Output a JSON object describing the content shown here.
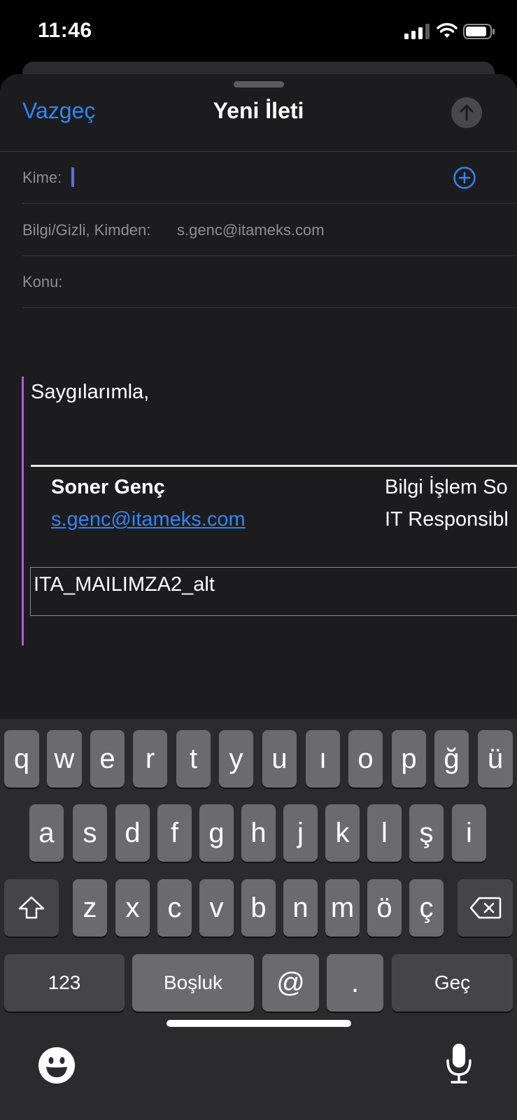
{
  "status_bar": {
    "time": "11:46",
    "icons": [
      "signal-icon",
      "wifi-icon",
      "battery-icon"
    ]
  },
  "compose": {
    "cancel_label": "Vazgeç",
    "title": "Yeni İleti",
    "send_icon": "arrow-up-icon",
    "to_label": "Kime:",
    "cc_from_label": "Bilgi/Gizli, Kimden:",
    "from_value": "s.genc@itameks.com",
    "subject_label": "Konu:",
    "add_contact_icon": "plus-circle-icon"
  },
  "body": {
    "greeting": "Saygılarımla,",
    "signature": {
      "name": "Soner Genç",
      "email": "s.genc@itameks.com",
      "title_tr": "Bilgi İşlem So",
      "title_en": "IT Responsibl",
      "image_alt": "ITA_MAILIMZA2_alt"
    }
  },
  "keyboard": {
    "row1": [
      "q",
      "w",
      "e",
      "r",
      "t",
      "y",
      "u",
      "ı",
      "o",
      "p",
      "ğ",
      "ü"
    ],
    "row2": [
      "a",
      "s",
      "d",
      "f",
      "g",
      "h",
      "j",
      "k",
      "l",
      "ş",
      "i"
    ],
    "row3": [
      "z",
      "x",
      "c",
      "v",
      "b",
      "n",
      "m",
      "ö",
      "ç"
    ],
    "numbers_label": "123",
    "space_label": "Boşluk",
    "at_label": "@",
    "period_label": ".",
    "go_label": "Geç",
    "shift_icon": "shift-icon",
    "delete_icon": "delete-icon",
    "emoji_icon": "emoji-icon",
    "mic_icon": "microphone-icon"
  },
  "colors": {
    "accent": "#2f86f6",
    "sheet_bg": "#1c1c1e",
    "keyboard_bg": "#2b2b2d",
    "key": "#6b6b6e",
    "body_bar": "#b45ad8"
  }
}
